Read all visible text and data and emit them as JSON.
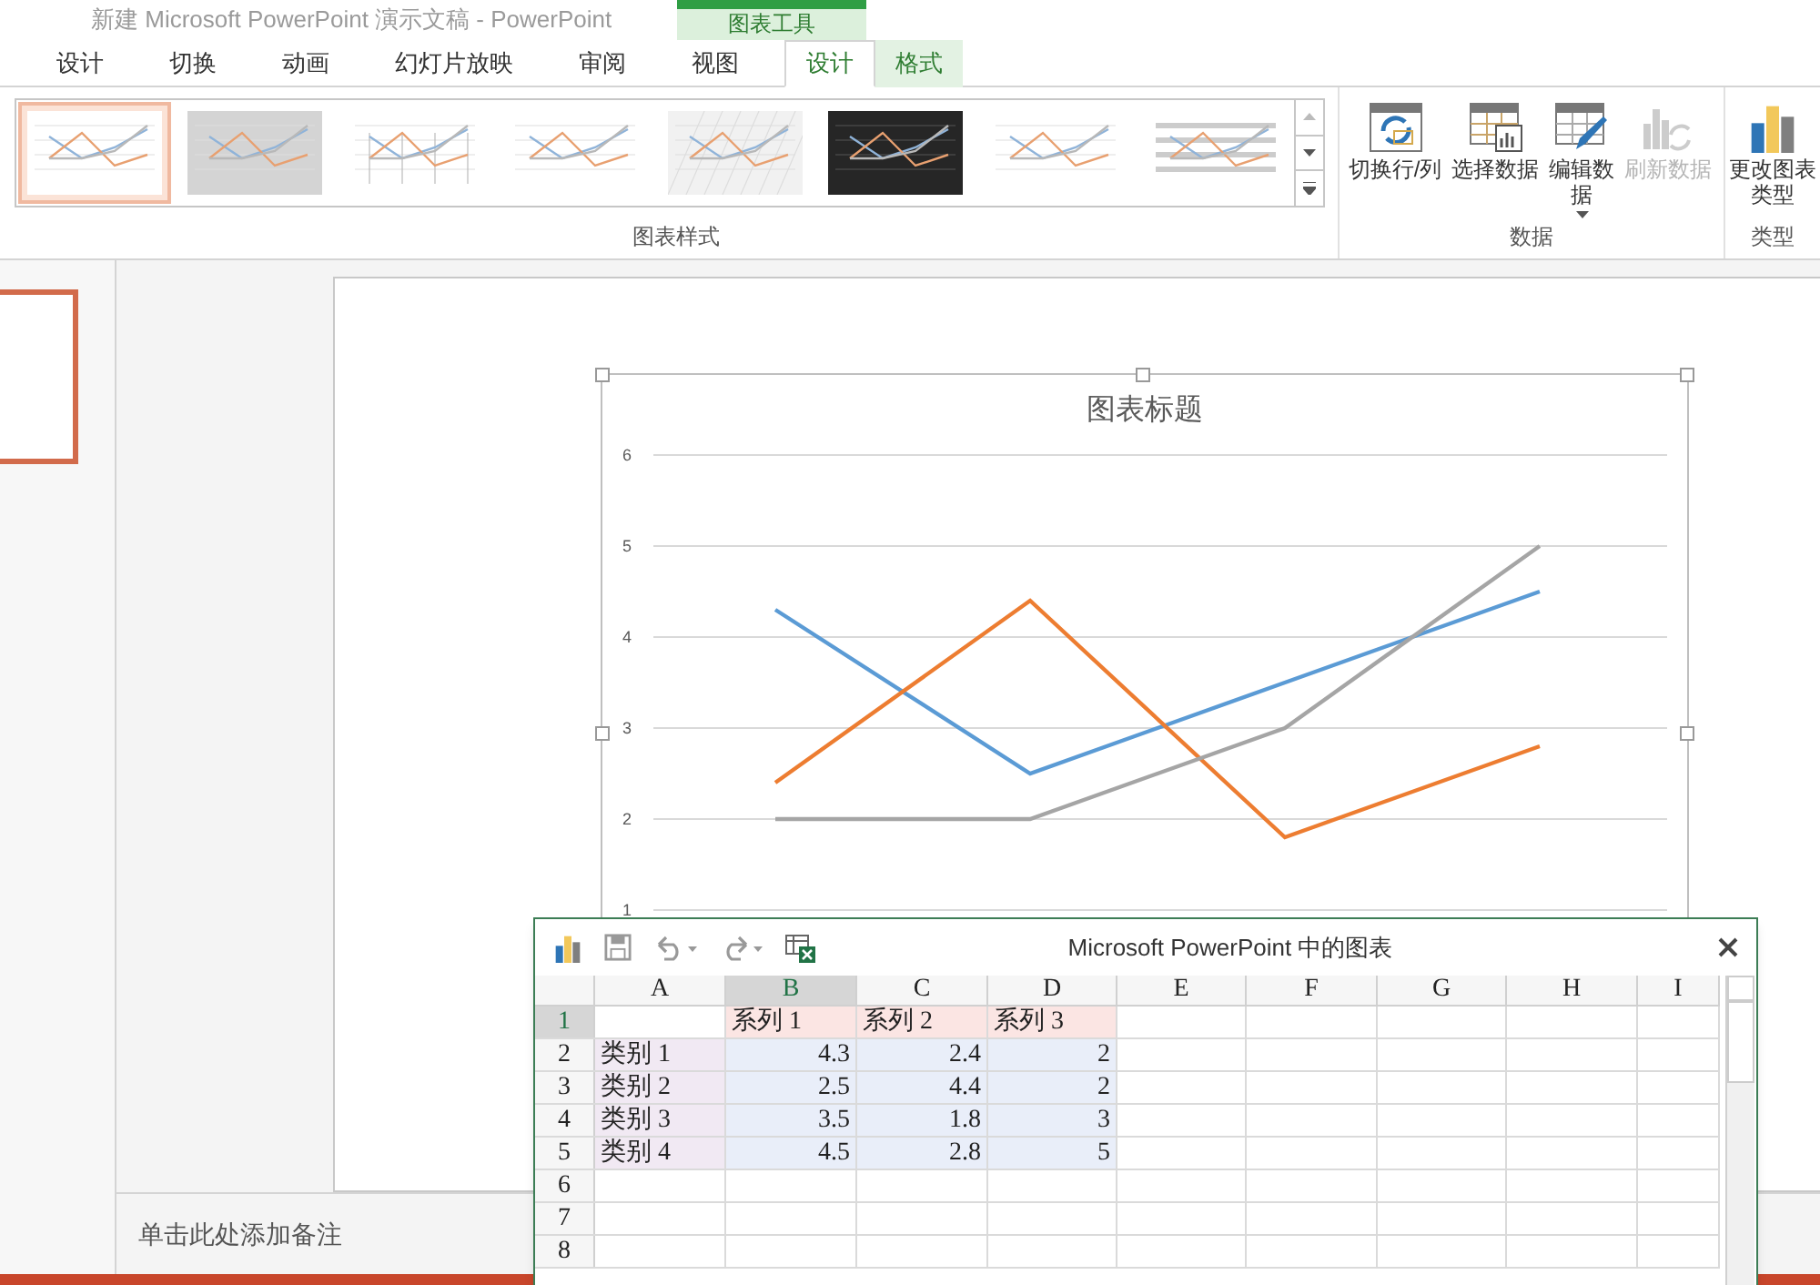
{
  "window": {
    "title": "新建 Microsoft PowerPoint 演示文稿 - PowerPoint"
  },
  "context_tab_group": {
    "label": "图表工具"
  },
  "tabs": [
    {
      "label": "设计",
      "selected": false,
      "context": false
    },
    {
      "label": "切换",
      "selected": false,
      "context": false
    },
    {
      "label": "动画",
      "selected": false,
      "context": false
    },
    {
      "label": "幻灯片放映",
      "selected": false,
      "context": false
    },
    {
      "label": "审阅",
      "selected": false,
      "context": false
    },
    {
      "label": "视图",
      "selected": false,
      "context": false
    },
    {
      "label": "设计",
      "selected": true,
      "context": true
    },
    {
      "label": "格式",
      "selected": false,
      "context": true
    }
  ],
  "chart_styles": {
    "label": "图表样式",
    "items": [
      {
        "kind": "plain",
        "selected": true
      },
      {
        "kind": "gray",
        "selected": false
      },
      {
        "kind": "droplines",
        "selected": false
      },
      {
        "kind": "plain",
        "selected": false
      },
      {
        "kind": "hatched",
        "selected": false
      },
      {
        "kind": "dark",
        "selected": false
      },
      {
        "kind": "plain",
        "selected": false
      },
      {
        "kind": "striped",
        "selected": false
      }
    ]
  },
  "data_group": {
    "label": "数据",
    "buttons": [
      {
        "kind": "switch",
        "label": "切换行/列",
        "disabled": false,
        "dropdown": false
      },
      {
        "kind": "select",
        "label": "选择数据",
        "disabled": false,
        "dropdown": false
      },
      {
        "kind": "edit",
        "label": "编辑数据",
        "disabled": false,
        "dropdown": true
      },
      {
        "kind": "refresh",
        "label": "刷新数据",
        "disabled": true,
        "dropdown": false
      }
    ]
  },
  "type_group": {
    "label": "类型",
    "buttons": [
      {
        "label": "更改图表类型"
      }
    ]
  },
  "slide": {
    "chart_data": {
      "type": "line",
      "title": "图表标题",
      "grid": true,
      "ylim": [
        1,
        6
      ],
      "yticks": [
        1,
        2,
        3,
        4,
        5,
        6
      ],
      "series": [
        {
          "color": "#5b9bd5",
          "values": [
            4.3,
            2.5,
            3.5,
            4.5
          ]
        },
        {
          "color": "#ed7d31",
          "values": [
            2.4,
            4.4,
            1.8,
            2.8
          ]
        },
        {
          "color": "#a5a5a5",
          "values": [
            2,
            2,
            3,
            5
          ]
        }
      ]
    }
  },
  "notes": {
    "placeholder": "单击此处添加备注"
  },
  "data_sheet": {
    "title": "Microsoft PowerPoint 中的图表",
    "columns": [
      {
        "label": "A",
        "selected": false
      },
      {
        "label": "B",
        "selected": true
      },
      {
        "label": "C",
        "selected": false
      },
      {
        "label": "D",
        "selected": false
      },
      {
        "label": "E",
        "selected": false
      },
      {
        "label": "F",
        "selected": false
      },
      {
        "label": "G",
        "selected": false
      },
      {
        "label": "H",
        "selected": false
      },
      {
        "label": "I",
        "selected": false
      }
    ],
    "rows": [
      {
        "label": "1",
        "selected": true,
        "cells": [
          "",
          "系列 1",
          "系列 2",
          "系列 3"
        ]
      },
      {
        "label": "2",
        "selected": false,
        "cells": [
          "类别 1",
          "4.3",
          "2.4",
          "2"
        ]
      },
      {
        "label": "3",
        "selected": false,
        "cells": [
          "类别 2",
          "2.5",
          "4.4",
          "2"
        ]
      },
      {
        "label": "4",
        "selected": false,
        "cells": [
          "类别 3",
          "3.5",
          "1.8",
          "3"
        ]
      },
      {
        "label": "5",
        "selected": false,
        "cells": [
          "类别 4",
          "4.5",
          "2.8",
          "5"
        ]
      },
      {
        "label": "6",
        "selected": false,
        "cells": []
      },
      {
        "label": "7",
        "selected": false,
        "cells": []
      },
      {
        "label": "8",
        "selected": false,
        "cells": []
      }
    ]
  }
}
